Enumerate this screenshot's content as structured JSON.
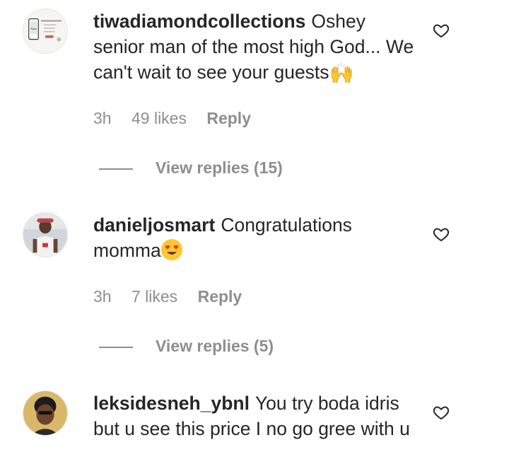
{
  "comments": [
    {
      "username": "tiwadiamondcollections",
      "text": "Oshey senior man of the most high God... We can't wait to see your guests",
      "emoji": "raising-hands",
      "time": "3h",
      "likes": "49 likes",
      "reply": "Reply",
      "view_replies": "View replies (15)"
    },
    {
      "username": "danieljosmart",
      "text": "Congratulations momma",
      "emoji": "heart-eyes",
      "time": "3h",
      "likes": "7 likes",
      "reply": "Reply",
      "view_replies": "View replies (5)"
    },
    {
      "username": "leksidesneh_ybnl",
      "text": "You try boda idris but u see this price I no go gree with u",
      "time": "",
      "likes": "",
      "reply": ""
    }
  ],
  "icons": {
    "like": "heart-outline-icon"
  },
  "colors": {
    "text": "#262626",
    "muted": "#8e8e8e",
    "background": "#ffffff"
  }
}
